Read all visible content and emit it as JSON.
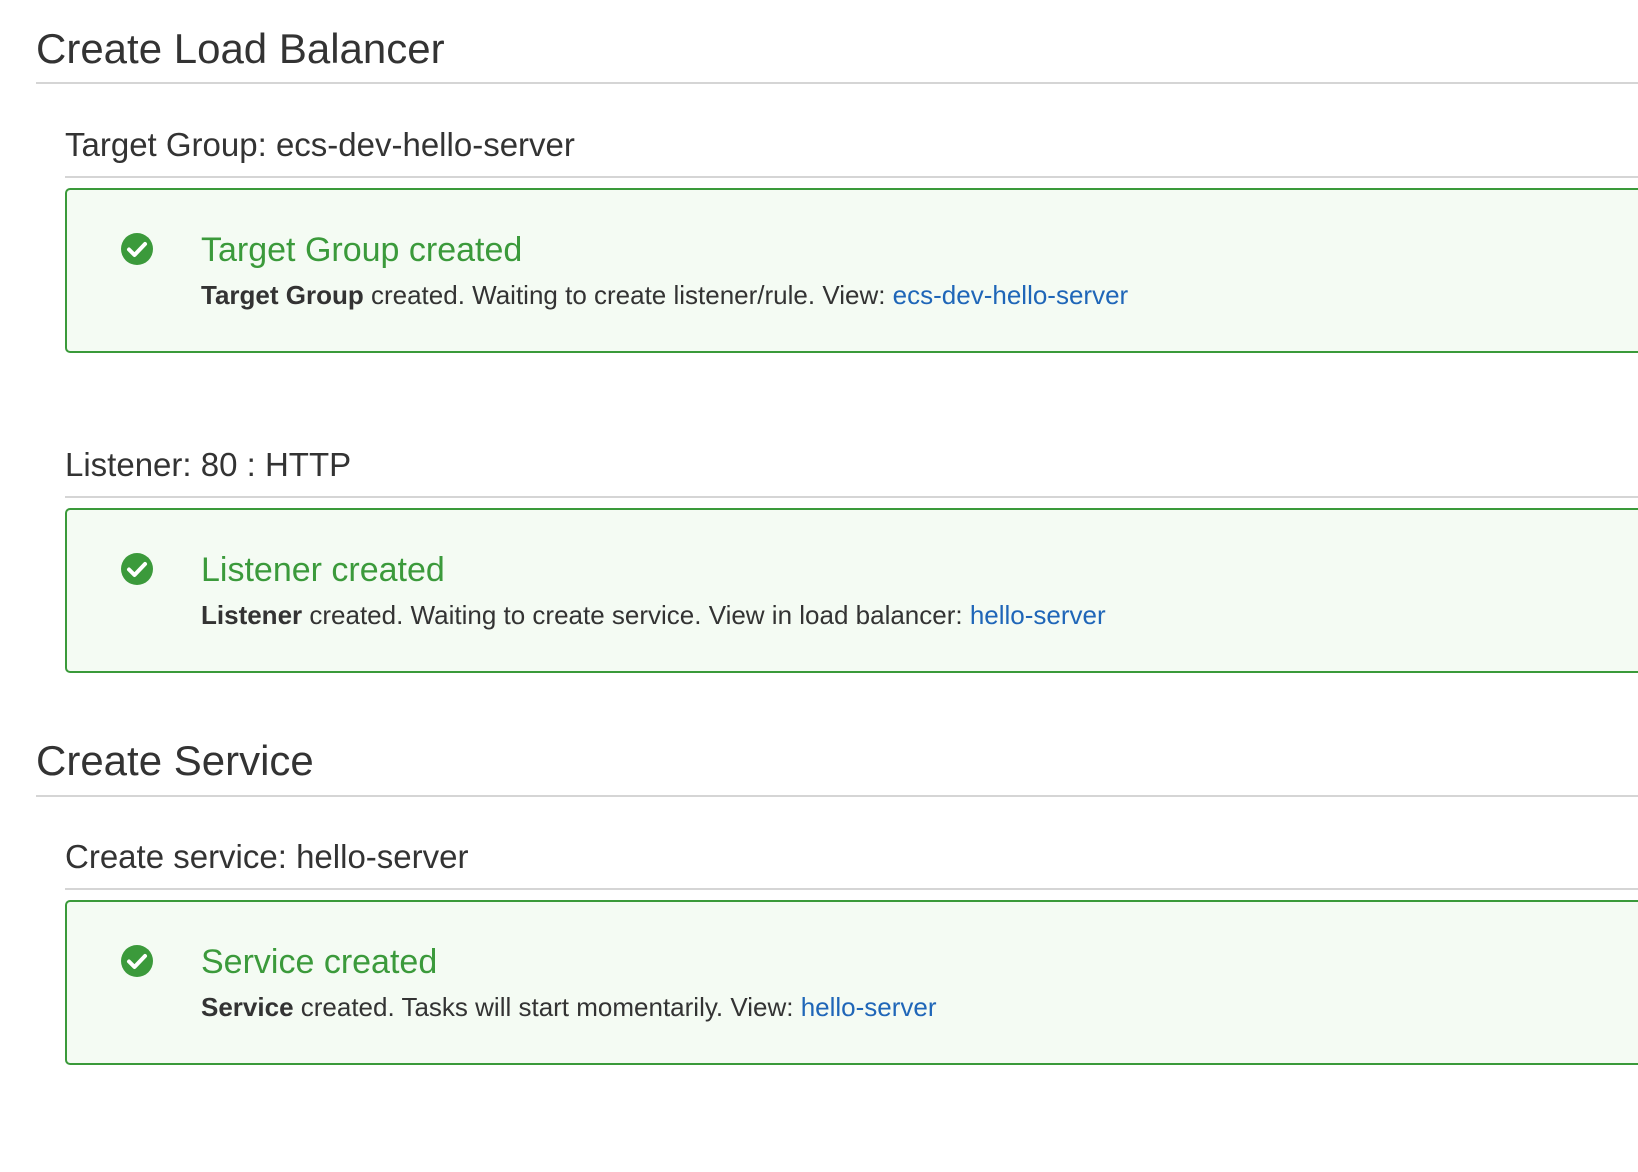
{
  "sections": [
    {
      "title": "Create Load Balancer",
      "items": [
        {
          "subtitle": "Target Group: ecs-dev-hello-server",
          "alert": {
            "icon": "check-circle-icon",
            "title": "Target Group created",
            "bold": "Target Group",
            "text": " created. Waiting to create listener/rule. View: ",
            "link": "ecs-dev-hello-server"
          }
        },
        {
          "subtitle": "Listener: 80 : HTTP",
          "alert": {
            "icon": "check-circle-icon",
            "title": "Listener created",
            "bold": "Listener",
            "text": " created. Waiting to create service. View in load balancer: ",
            "link": "hello-server"
          }
        }
      ]
    },
    {
      "title": "Create Service",
      "items": [
        {
          "subtitle": "Create service: hello-server",
          "alert": {
            "icon": "check-circle-icon",
            "title": "Service created",
            "bold": "Service",
            "text": " created. Tasks will start momentarily. View: ",
            "link": "hello-server"
          }
        }
      ]
    }
  ],
  "colors": {
    "success_green": "#3b9a3b",
    "alert_background": "#f4fbf3",
    "link_blue": "#1f66b8",
    "text": "#333333",
    "rule": "#d5d5d5"
  }
}
